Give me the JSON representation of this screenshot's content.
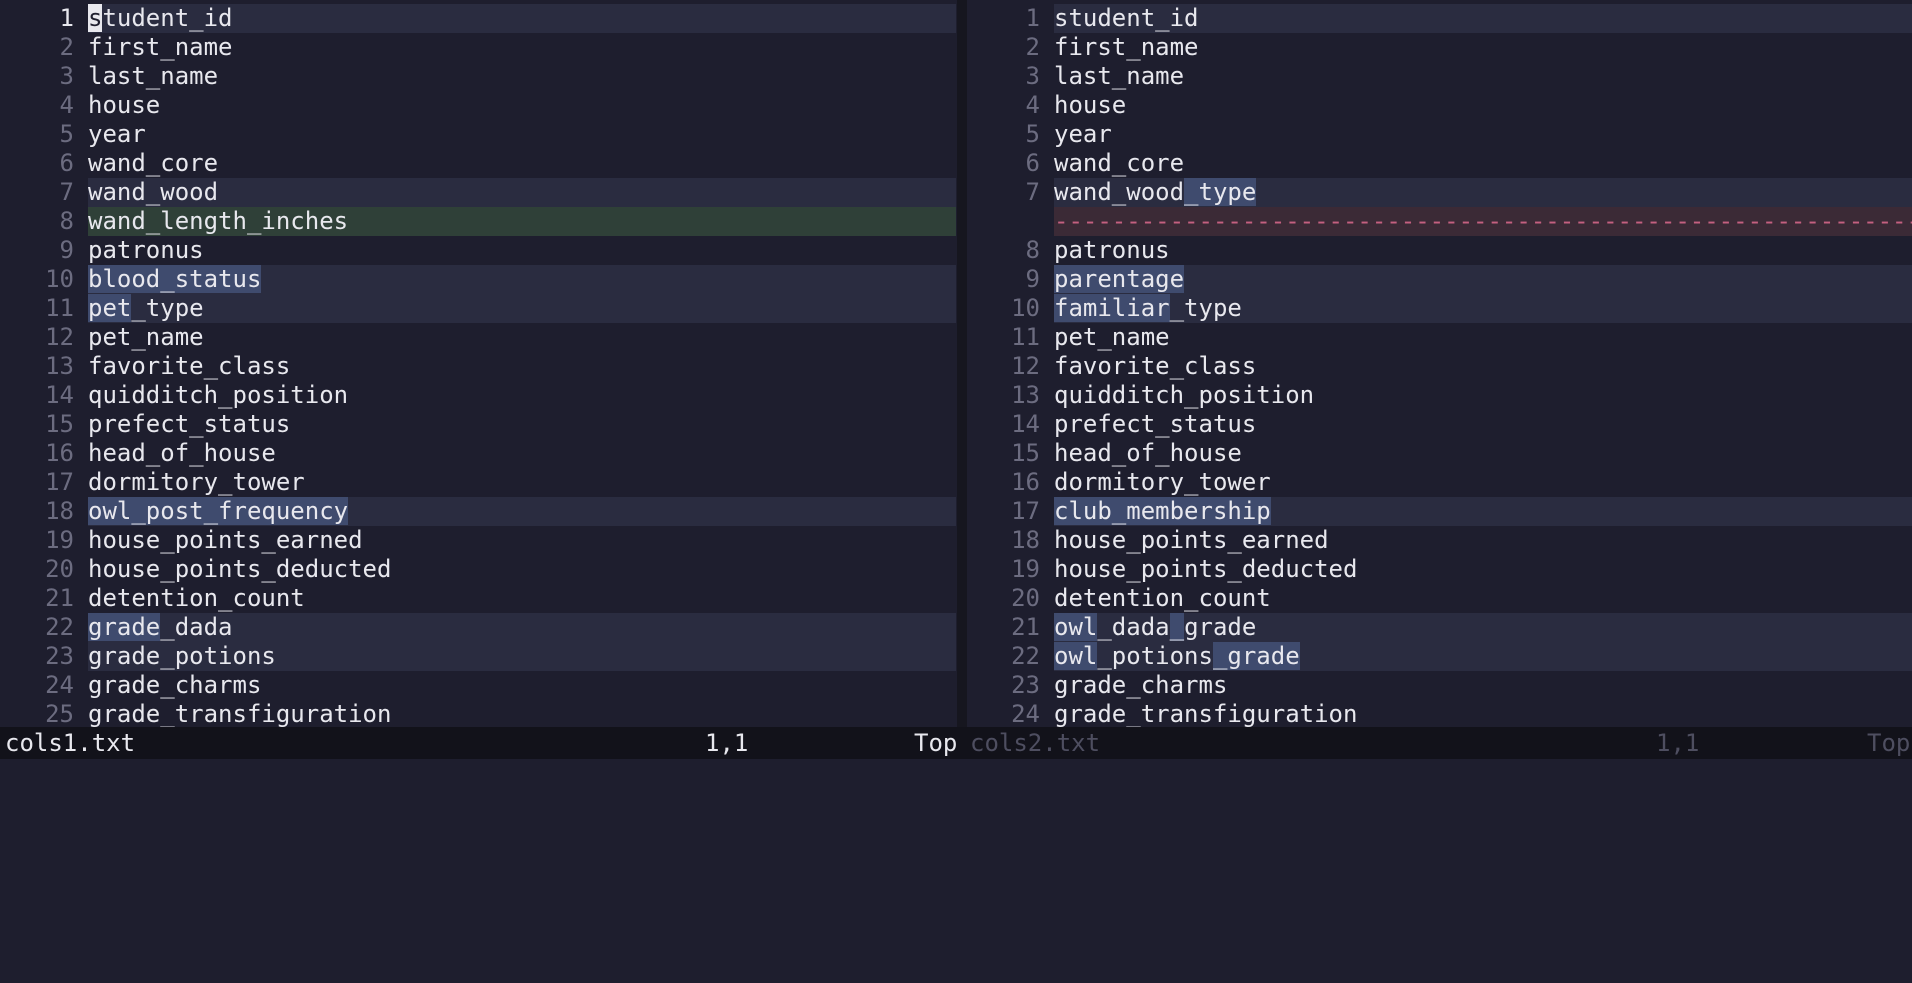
{
  "colors": {
    "background": "#1e1e2e",
    "change_line": "#2a2c40",
    "change_text": "#3f4b6e",
    "added_line": "#2f4038",
    "deleted_filler": "#3b2a36"
  },
  "left": {
    "file": "cols1.txt",
    "position": "1,1",
    "scroll": "Top",
    "lines": [
      {
        "num": "1",
        "segments": [
          {
            "t": "s",
            "cur": true
          },
          {
            "t": "tudent_id"
          }
        ],
        "type": "change"
      },
      {
        "num": "2",
        "segments": [
          {
            "t": "first_name"
          }
        ]
      },
      {
        "num": "3",
        "segments": [
          {
            "t": "last_name"
          }
        ]
      },
      {
        "num": "4",
        "segments": [
          {
            "t": "house"
          }
        ]
      },
      {
        "num": "5",
        "segments": [
          {
            "t": "year"
          }
        ]
      },
      {
        "num": "6",
        "segments": [
          {
            "t": "wand_core"
          }
        ]
      },
      {
        "num": "7",
        "segments": [
          {
            "t": "wand_wood"
          }
        ],
        "type": "change"
      },
      {
        "num": "8",
        "segments": [
          {
            "t": "wand_length_inches"
          }
        ],
        "type": "add"
      },
      {
        "num": "9",
        "segments": [
          {
            "t": "patronus"
          }
        ]
      },
      {
        "num": "10",
        "segments": [
          {
            "t": "blood_status",
            "hl": true
          }
        ],
        "type": "change"
      },
      {
        "num": "11",
        "segments": [
          {
            "t": "pet",
            "hl": true
          },
          {
            "t": "_type"
          }
        ],
        "type": "change"
      },
      {
        "num": "12",
        "segments": [
          {
            "t": "pet_name"
          }
        ]
      },
      {
        "num": "13",
        "segments": [
          {
            "t": "favorite_class"
          }
        ]
      },
      {
        "num": "14",
        "segments": [
          {
            "t": "quidditch_position"
          }
        ]
      },
      {
        "num": "15",
        "segments": [
          {
            "t": "prefect_status"
          }
        ]
      },
      {
        "num": "16",
        "segments": [
          {
            "t": "head_of_house"
          }
        ]
      },
      {
        "num": "17",
        "segments": [
          {
            "t": "dormitory_tower"
          }
        ]
      },
      {
        "num": "18",
        "segments": [
          {
            "t": "owl_post_frequency",
            "hl": true
          }
        ],
        "type": "change"
      },
      {
        "num": "19",
        "segments": [
          {
            "t": "house_points_earned"
          }
        ]
      },
      {
        "num": "20",
        "segments": [
          {
            "t": "house_points_deducted"
          }
        ]
      },
      {
        "num": "21",
        "segments": [
          {
            "t": "detention_count"
          }
        ]
      },
      {
        "num": "22",
        "segments": [
          {
            "t": "grade",
            "hl": true
          },
          {
            "t": "_dada"
          }
        ],
        "type": "change"
      },
      {
        "num": "23",
        "segments": [
          {
            "t": "grade_potions"
          }
        ],
        "type": "change"
      },
      {
        "num": "24",
        "segments": [
          {
            "t": "grade_charms"
          }
        ]
      },
      {
        "num": "25",
        "segments": [
          {
            "t": "grade_transfiguration"
          }
        ]
      }
    ]
  },
  "right": {
    "file": "cols2.txt",
    "position": "1,1",
    "scroll": "Top",
    "lines": [
      {
        "num": "1",
        "segments": [
          {
            "t": "student_id"
          }
        ],
        "type": "change"
      },
      {
        "num": "2",
        "segments": [
          {
            "t": "first_name"
          }
        ]
      },
      {
        "num": "3",
        "segments": [
          {
            "t": "last_name"
          }
        ]
      },
      {
        "num": "4",
        "segments": [
          {
            "t": "house"
          }
        ]
      },
      {
        "num": "5",
        "segments": [
          {
            "t": "year"
          }
        ]
      },
      {
        "num": "6",
        "segments": [
          {
            "t": "wand_core"
          }
        ]
      },
      {
        "num": "7",
        "segments": [
          {
            "t": "wand_wood"
          },
          {
            "t": "_type",
            "hl": true
          }
        ],
        "type": "change"
      },
      {
        "num": "",
        "segments": [
          {
            "t": "----------------------------------------------------------------------------------"
          }
        ],
        "type": "filler"
      },
      {
        "num": "8",
        "segments": [
          {
            "t": "patronus"
          }
        ]
      },
      {
        "num": "9",
        "segments": [
          {
            "t": "parentage",
            "hl": true
          }
        ],
        "type": "change"
      },
      {
        "num": "10",
        "segments": [
          {
            "t": "familiar",
            "hl": true
          },
          {
            "t": "_type"
          }
        ],
        "type": "change"
      },
      {
        "num": "11",
        "segments": [
          {
            "t": "pet_name"
          }
        ]
      },
      {
        "num": "12",
        "segments": [
          {
            "t": "favorite_class"
          }
        ]
      },
      {
        "num": "13",
        "segments": [
          {
            "t": "quidditch_position"
          }
        ]
      },
      {
        "num": "14",
        "segments": [
          {
            "t": "prefect_status"
          }
        ]
      },
      {
        "num": "15",
        "segments": [
          {
            "t": "head_of_house"
          }
        ]
      },
      {
        "num": "16",
        "segments": [
          {
            "t": "dormitory_tower"
          }
        ]
      },
      {
        "num": "17",
        "segments": [
          {
            "t": "club_membership",
            "hl": true
          }
        ],
        "type": "change"
      },
      {
        "num": "18",
        "segments": [
          {
            "t": "house_points_earned"
          }
        ]
      },
      {
        "num": "19",
        "segments": [
          {
            "t": "house_points_deducted"
          }
        ]
      },
      {
        "num": "20",
        "segments": [
          {
            "t": "detention_count"
          }
        ]
      },
      {
        "num": "21",
        "segments": [
          {
            "t": "owl",
            "hl": true
          },
          {
            "t": "_dada"
          },
          {
            "t": "_",
            "hl": true
          },
          {
            "t": "grade"
          }
        ],
        "type": "change"
      },
      {
        "num": "22",
        "segments": [
          {
            "t": "owl",
            "hl": true
          },
          {
            "t": "_potions"
          },
          {
            "t": "_grade",
            "hl": true
          }
        ],
        "type": "change"
      },
      {
        "num": "23",
        "segments": [
          {
            "t": "grade_charms"
          }
        ]
      },
      {
        "num": "24",
        "segments": [
          {
            "t": "grade_transfiguration"
          }
        ]
      }
    ]
  }
}
